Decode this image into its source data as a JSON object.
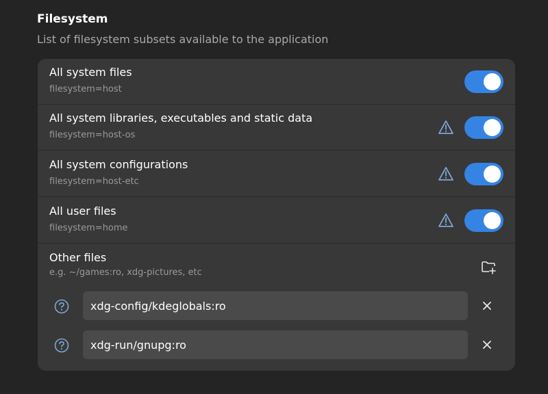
{
  "section": {
    "title": "Filesystem",
    "subtitle": "List of filesystem subsets available to the application"
  },
  "rows": [
    {
      "title": "All system files",
      "subtitle": "filesystem=host",
      "warning": false,
      "enabled": true
    },
    {
      "title": "All system libraries, executables and static data",
      "subtitle": "filesystem=host-os",
      "warning": true,
      "enabled": true
    },
    {
      "title": "All system configurations",
      "subtitle": "filesystem=host-etc",
      "warning": true,
      "enabled": true
    },
    {
      "title": "All user files",
      "subtitle": "filesystem=home",
      "warning": true,
      "enabled": true
    }
  ],
  "other": {
    "title": "Other files",
    "subtitle": "e.g. ~/games:ro, xdg-pictures, etc",
    "entries": [
      {
        "value": "xdg-config/kdeglobals:ro"
      },
      {
        "value": "xdg-run/gnupg:ro"
      }
    ]
  },
  "colors": {
    "accent": "#3584e4",
    "background": "#242424",
    "card": "#383838",
    "field": "#4a4a4a",
    "help": "#7fa6d6"
  },
  "icons": {
    "warning": "warning-icon",
    "add_folder": "folder-add-icon",
    "help": "help-icon",
    "remove": "close-icon"
  }
}
